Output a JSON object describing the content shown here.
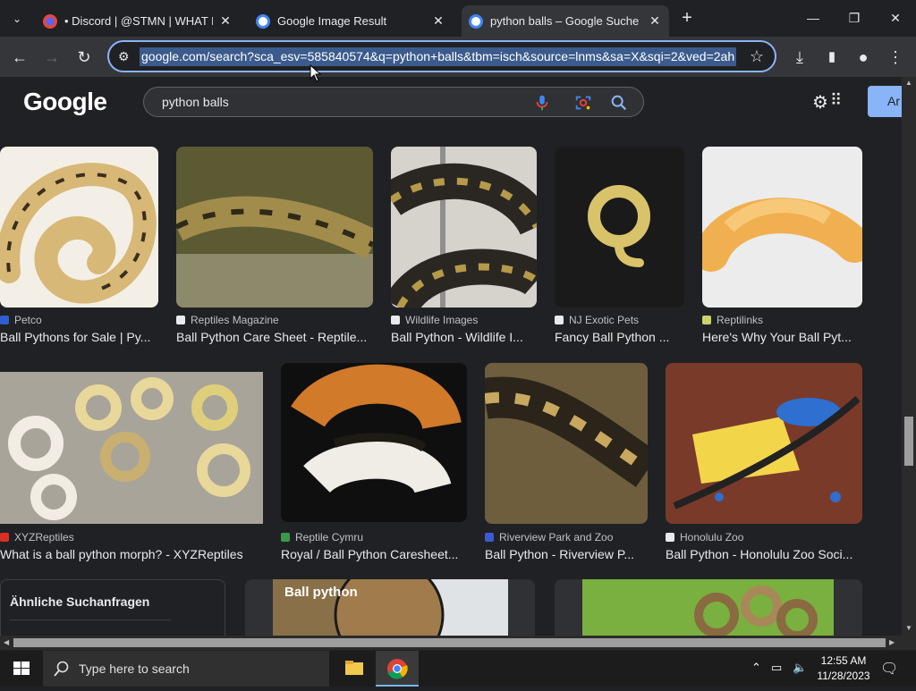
{
  "browser": {
    "tabs": [
      {
        "title": "• Discord | @STMN | WHAT Ma",
        "favicon": "discord-icon"
      },
      {
        "title": "Google Image Result",
        "favicon": "google-icon"
      },
      {
        "title": "python balls – Google Suche",
        "favicon": "google-icon"
      }
    ],
    "url": "google.com/search?sca_esv=585840574&q=python+balls&tbm=isch&source=lnms&sa=X&sqi=2&ved=2ah"
  },
  "google": {
    "logo": "Google",
    "query": "python balls",
    "signin_label": "Ar",
    "related_title": "Ähnliche Suchanfragen"
  },
  "results": [
    {
      "source": "Petco",
      "title": "Ball Pythons for Sale | Py...",
      "colors": [
        "#f3efe6",
        "#d8b877",
        "#3b2e1c"
      ]
    },
    {
      "source": "Reptiles Magazine",
      "title": "Ball Python Care Sheet - Reptile...",
      "colors": [
        "#5b5a33",
        "#a28c4c",
        "#2e2a18"
      ]
    },
    {
      "source": "Wildlife Images",
      "title": "Ball Python - Wildlife I...",
      "colors": [
        "#d6d3cc",
        "#2a2723",
        "#b59a4a"
      ]
    },
    {
      "source": "NJ Exotic Pets",
      "title": "Fancy Ball Python ...",
      "colors": [
        "#1a1a1a",
        "#d9c36a",
        "#333333"
      ]
    },
    {
      "source": "Reptilinks",
      "title": "Here's Why Your Ball Pyt...",
      "colors": [
        "#ececec",
        "#f0b050",
        "#d9d9d9"
      ]
    },
    {
      "source": "XYZReptiles",
      "title": "What is a ball python morph? - XYZReptiles",
      "colors": [
        "#a9a49a",
        "#e8d89a",
        "#f2ece4"
      ]
    },
    {
      "source": "Reptile Cymru",
      "title": "Royal / Ball Python Caresheet...",
      "colors": [
        "#0f0f0f",
        "#d07a2a",
        "#f0ece6"
      ]
    },
    {
      "source": "Riverview Park and Zoo",
      "title": "Ball Python - Riverview P...",
      "colors": [
        "#6e5e3e",
        "#2b241a",
        "#c8a860"
      ]
    },
    {
      "source": "Honolulu Zoo",
      "title": "Ball Python - Honolulu Zoo Soci...",
      "colors": [
        "#7a3a2a",
        "#f3d54a",
        "#2e6fcf"
      ]
    }
  ],
  "bottom_cards": [
    {
      "label": "Ball python"
    },
    {
      "label": ""
    }
  ],
  "taskbar": {
    "search_placeholder": "Type here to search",
    "time": "12:55 AM",
    "date": "11/28/2023"
  }
}
